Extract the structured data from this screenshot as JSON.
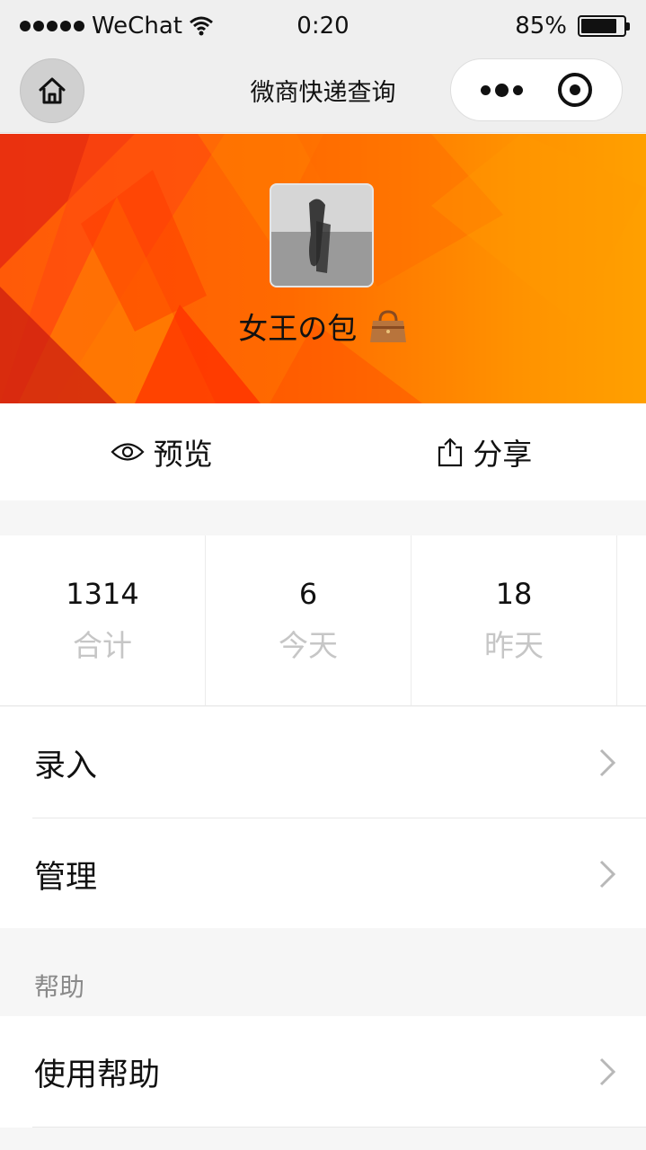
{
  "status_bar": {
    "carrier": "WeChat",
    "time": "0:20",
    "battery": "85%",
    "battery_level": 0.85
  },
  "nav": {
    "title": "微商快递查询"
  },
  "profile": {
    "shop_name": "女王の包"
  },
  "actions": {
    "preview_label": "预览",
    "share_label": "分享"
  },
  "stats": [
    {
      "value": "1314",
      "label": "合计"
    },
    {
      "value": "6",
      "label": "今天"
    },
    {
      "value": "18",
      "label": "昨天"
    }
  ],
  "menu": {
    "entry_label": "录入",
    "manage_label": "管理"
  },
  "help_section": {
    "header": "帮助",
    "items": [
      {
        "label": "使用帮助"
      }
    ]
  },
  "colors": {
    "banner_start": "#ff5a08",
    "banner_end": "#ffa000",
    "chevron": "#b8b8b8",
    "muted_label": "#c6c6c6"
  }
}
